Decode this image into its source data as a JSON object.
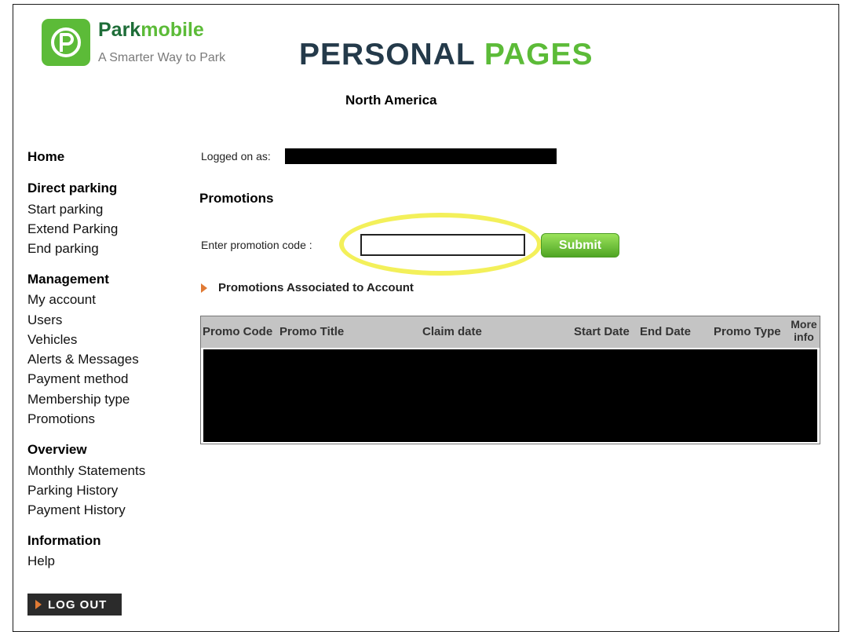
{
  "brand": {
    "name_part1": "Park",
    "name_part2": "mobile",
    "tagline": "A Smarter Way to Park",
    "logo_icon": "parkmobile-p-logo-icon",
    "logo_color": "#5cbb38",
    "dark_green": "#1e6d38"
  },
  "header": {
    "title_part1": "PERSONAL",
    "title_part2": "PAGES",
    "region": "North America"
  },
  "sidebar": {
    "sections": [
      {
        "heading": "Home",
        "items": []
      },
      {
        "heading": "Direct parking",
        "items": [
          "Start parking",
          "Extend Parking",
          "End parking"
        ]
      },
      {
        "heading": "Management",
        "items": [
          "My account",
          "Users",
          "Vehicles",
          "Alerts & Messages",
          "Payment method",
          "Membership type",
          "Promotions"
        ]
      },
      {
        "heading": "Overview",
        "items": [
          "Monthly Statements",
          "Parking History",
          "Payment History"
        ]
      },
      {
        "heading": "Information",
        "items": [
          "Help"
        ]
      }
    ],
    "logout_label": "LOG OUT"
  },
  "main": {
    "logged_on_label": "Logged on as:",
    "section_title": "Promotions",
    "promo_label": "Enter promotion code :",
    "promo_value": "",
    "submit_label": "Submit",
    "associated_label": "Promotions Associated to Account",
    "table": {
      "columns": [
        "Promo Code",
        "Promo Title",
        "Claim date",
        "Start Date",
        "End Date",
        "Promo Type",
        "More info"
      ]
    }
  },
  "colors": {
    "accent_green": "#5cbb38",
    "arrow_orange": "#e07a34",
    "highlight_yellow": "#f3f05a",
    "table_header": "#c4c4c4"
  }
}
